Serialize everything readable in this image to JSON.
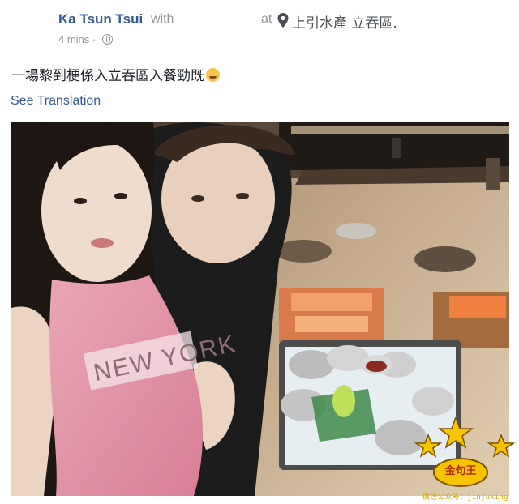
{
  "post": {
    "author": "Ka Tsun Tsui",
    "with_word": "with",
    "at_word": "at",
    "location": "上引水產 立吞區.",
    "timestamp": "4 mins",
    "audience_icon": "globe-icon",
    "text": "一場黎到梗係入立吞區入餐勁既",
    "text_emoji": "grinning-sweat-emoji",
    "see_translation": "See Translation"
  },
  "photo": {
    "shirt_text": "NEW YORK"
  },
  "watermark": {
    "badge_label": "金句王",
    "caption": "微信公众号：jinjuking"
  }
}
